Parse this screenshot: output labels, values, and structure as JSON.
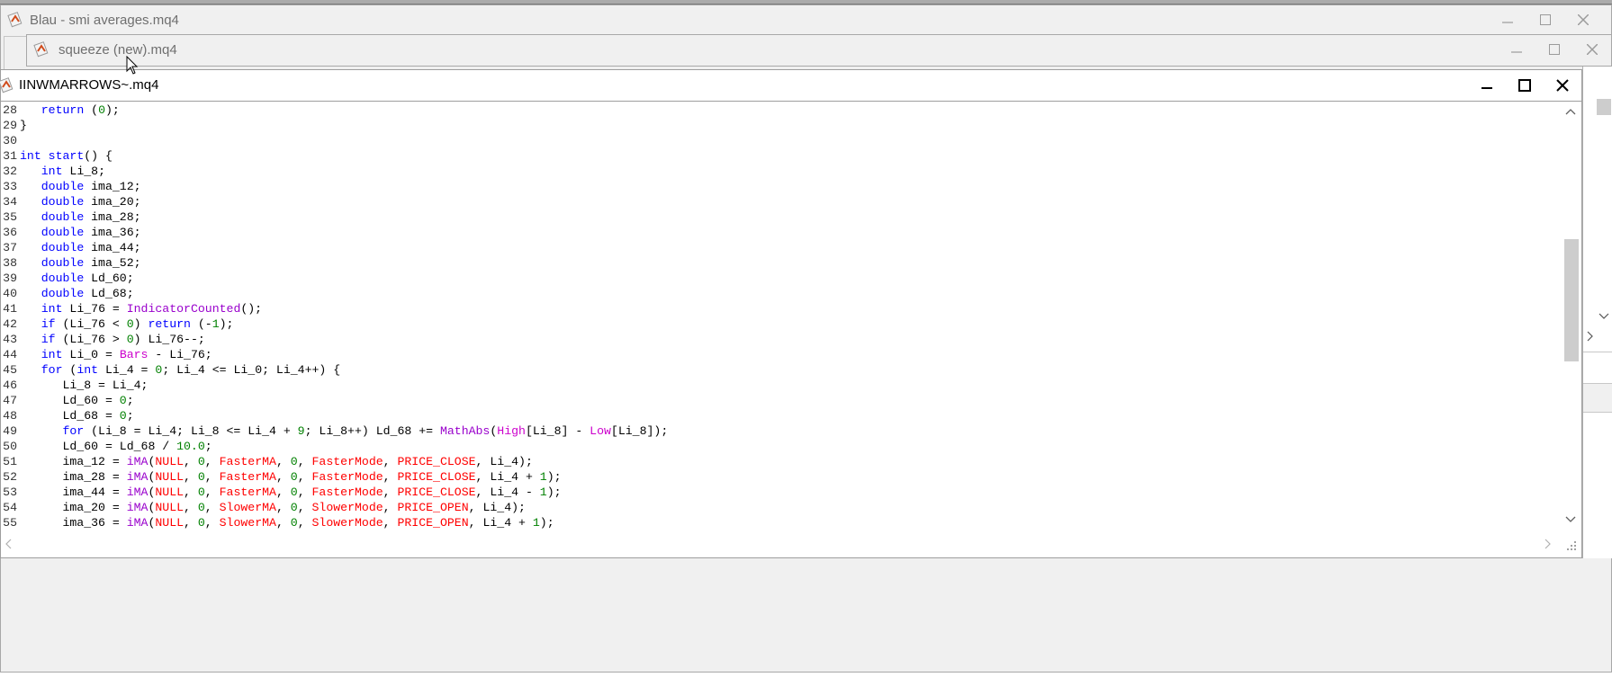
{
  "windows": {
    "back": {
      "title": "Blau - smi averages.mq4"
    },
    "middle": {
      "title": "squeeze (new).mq4"
    },
    "active": {
      "title": "IINWMARROWS~.mq4"
    }
  },
  "icons": {
    "app": "mq4-file-icon",
    "minimize": "minimize-icon",
    "maximize": "maximize-icon",
    "close": "close-icon"
  },
  "colors": {
    "keyword": "#0000ff",
    "function": "#9900cc",
    "number": "#008000",
    "macro": "#ff0000",
    "constant": "#cc00cc"
  },
  "code_lines": [
    {
      "num": "28",
      "tokens": [
        [
          "",
          "   "
        ],
        [
          "kw",
          "return"
        ],
        [
          "",
          " ("
        ],
        [
          "num",
          "0"
        ],
        [
          "",
          ");"
        ]
      ]
    },
    {
      "num": "29",
      "tokens": [
        [
          "",
          "}"
        ]
      ]
    },
    {
      "num": "30",
      "tokens": [
        [
          "",
          ""
        ]
      ]
    },
    {
      "num": "31",
      "tokens": [
        [
          "kw",
          "int"
        ],
        [
          "",
          " "
        ],
        [
          "kw",
          "start"
        ],
        [
          "",
          "() {"
        ]
      ]
    },
    {
      "num": "32",
      "tokens": [
        [
          "",
          "   "
        ],
        [
          "kw",
          "int"
        ],
        [
          "",
          " Li_8;"
        ]
      ]
    },
    {
      "num": "33",
      "tokens": [
        [
          "",
          "   "
        ],
        [
          "kw",
          "double"
        ],
        [
          "",
          " ima_12;"
        ]
      ]
    },
    {
      "num": "34",
      "tokens": [
        [
          "",
          "   "
        ],
        [
          "kw",
          "double"
        ],
        [
          "",
          " ima_20;"
        ]
      ]
    },
    {
      "num": "35",
      "tokens": [
        [
          "",
          "   "
        ],
        [
          "kw",
          "double"
        ],
        [
          "",
          " ima_28;"
        ]
      ]
    },
    {
      "num": "36",
      "tokens": [
        [
          "",
          "   "
        ],
        [
          "kw",
          "double"
        ],
        [
          "",
          " ima_36;"
        ]
      ]
    },
    {
      "num": "37",
      "tokens": [
        [
          "",
          "   "
        ],
        [
          "kw",
          "double"
        ],
        [
          "",
          " ima_44;"
        ]
      ]
    },
    {
      "num": "38",
      "tokens": [
        [
          "",
          "   "
        ],
        [
          "kw",
          "double"
        ],
        [
          "",
          " ima_52;"
        ]
      ]
    },
    {
      "num": "39",
      "tokens": [
        [
          "",
          "   "
        ],
        [
          "kw",
          "double"
        ],
        [
          "",
          " Ld_60;"
        ]
      ]
    },
    {
      "num": "40",
      "tokens": [
        [
          "",
          "   "
        ],
        [
          "kw",
          "double"
        ],
        [
          "",
          " Ld_68;"
        ]
      ]
    },
    {
      "num": "41",
      "tokens": [
        [
          "",
          "   "
        ],
        [
          "kw",
          "int"
        ],
        [
          "",
          " Li_76 = "
        ],
        [
          "fn",
          "IndicatorCounted"
        ],
        [
          "",
          "();"
        ]
      ]
    },
    {
      "num": "42",
      "tokens": [
        [
          "",
          "   "
        ],
        [
          "kw",
          "if"
        ],
        [
          "",
          " (Li_76 < "
        ],
        [
          "num",
          "0"
        ],
        [
          "",
          ") "
        ],
        [
          "kw",
          "return"
        ],
        [
          "",
          " (-"
        ],
        [
          "num",
          "1"
        ],
        [
          "",
          ");"
        ]
      ]
    },
    {
      "num": "43",
      "tokens": [
        [
          "",
          "   "
        ],
        [
          "kw",
          "if"
        ],
        [
          "",
          " (Li_76 > "
        ],
        [
          "num",
          "0"
        ],
        [
          "",
          ") Li_76--;"
        ]
      ]
    },
    {
      "num": "44",
      "tokens": [
        [
          "",
          "   "
        ],
        [
          "kw",
          "int"
        ],
        [
          "",
          " Li_0 = "
        ],
        [
          "cst",
          "Bars"
        ],
        [
          "",
          " - Li_76;"
        ]
      ]
    },
    {
      "num": "45",
      "tokens": [
        [
          "",
          "   "
        ],
        [
          "kw",
          "for"
        ],
        [
          "",
          " ("
        ],
        [
          "kw",
          "int"
        ],
        [
          "",
          " Li_4 = "
        ],
        [
          "num",
          "0"
        ],
        [
          "",
          "; Li_4 <= Li_0; Li_4++) {"
        ]
      ]
    },
    {
      "num": "46",
      "tokens": [
        [
          "",
          "      Li_8 = Li_4;"
        ]
      ]
    },
    {
      "num": "47",
      "tokens": [
        [
          "",
          "      Ld_60 = "
        ],
        [
          "num",
          "0"
        ],
        [
          "",
          ";"
        ]
      ]
    },
    {
      "num": "48",
      "tokens": [
        [
          "",
          "      Ld_68 = "
        ],
        [
          "num",
          "0"
        ],
        [
          "",
          ";"
        ]
      ]
    },
    {
      "num": "49",
      "tokens": [
        [
          "",
          "      "
        ],
        [
          "kw",
          "for"
        ],
        [
          "",
          " (Li_8 = Li_4; Li_8 <= Li_4 + "
        ],
        [
          "num",
          "9"
        ],
        [
          "",
          "; Li_8++) Ld_68 += "
        ],
        [
          "fn",
          "MathAbs"
        ],
        [
          "",
          "("
        ],
        [
          "cst",
          "High"
        ],
        [
          "",
          "[Li_8] - "
        ],
        [
          "cst",
          "Low"
        ],
        [
          "",
          "[Li_8]);"
        ]
      ]
    },
    {
      "num": "50",
      "tokens": [
        [
          "",
          "      Ld_60 = Ld_68 / "
        ],
        [
          "num",
          "10.0"
        ],
        [
          "",
          ";"
        ]
      ]
    },
    {
      "num": "51",
      "tokens": [
        [
          "",
          "      ima_12 = "
        ],
        [
          "fn",
          "iMA"
        ],
        [
          "",
          "("
        ],
        [
          "mac",
          "NULL"
        ],
        [
          "",
          ", "
        ],
        [
          "num",
          "0"
        ],
        [
          "",
          ", "
        ],
        [
          "mac",
          "FasterMA"
        ],
        [
          "",
          ", "
        ],
        [
          "num",
          "0"
        ],
        [
          "",
          ", "
        ],
        [
          "mac",
          "FasterMode"
        ],
        [
          "",
          ", "
        ],
        [
          "mac",
          "PRICE_CLOSE"
        ],
        [
          "",
          ", Li_4);"
        ]
      ]
    },
    {
      "num": "52",
      "tokens": [
        [
          "",
          "      ima_28 = "
        ],
        [
          "fn",
          "iMA"
        ],
        [
          "",
          "("
        ],
        [
          "mac",
          "NULL"
        ],
        [
          "",
          ", "
        ],
        [
          "num",
          "0"
        ],
        [
          "",
          ", "
        ],
        [
          "mac",
          "FasterMA"
        ],
        [
          "",
          ", "
        ],
        [
          "num",
          "0"
        ],
        [
          "",
          ", "
        ],
        [
          "mac",
          "FasterMode"
        ],
        [
          "",
          ", "
        ],
        [
          "mac",
          "PRICE_CLOSE"
        ],
        [
          "",
          ", Li_4 + "
        ],
        [
          "num",
          "1"
        ],
        [
          "",
          ");"
        ]
      ]
    },
    {
      "num": "53",
      "tokens": [
        [
          "",
          "      ima_44 = "
        ],
        [
          "fn",
          "iMA"
        ],
        [
          "",
          "("
        ],
        [
          "mac",
          "NULL"
        ],
        [
          "",
          ", "
        ],
        [
          "num",
          "0"
        ],
        [
          "",
          ", "
        ],
        [
          "mac",
          "FasterMA"
        ],
        [
          "",
          ", "
        ],
        [
          "num",
          "0"
        ],
        [
          "",
          ", "
        ],
        [
          "mac",
          "FasterMode"
        ],
        [
          "",
          ", "
        ],
        [
          "mac",
          "PRICE_CLOSE"
        ],
        [
          "",
          ", Li_4 - "
        ],
        [
          "num",
          "1"
        ],
        [
          "",
          ");"
        ]
      ]
    },
    {
      "num": "54",
      "tokens": [
        [
          "",
          "      ima_20 = "
        ],
        [
          "fn",
          "iMA"
        ],
        [
          "",
          "("
        ],
        [
          "mac",
          "NULL"
        ],
        [
          "",
          ", "
        ],
        [
          "num",
          "0"
        ],
        [
          "",
          ", "
        ],
        [
          "mac",
          "SlowerMA"
        ],
        [
          "",
          ", "
        ],
        [
          "num",
          "0"
        ],
        [
          "",
          ", "
        ],
        [
          "mac",
          "SlowerMode"
        ],
        [
          "",
          ", "
        ],
        [
          "mac",
          "PRICE_OPEN"
        ],
        [
          "",
          ", Li_4);"
        ]
      ]
    },
    {
      "num": "55",
      "tokens": [
        [
          "",
          "      ima_36 = "
        ],
        [
          "fn",
          "iMA"
        ],
        [
          "",
          "("
        ],
        [
          "mac",
          "NULL"
        ],
        [
          "",
          ", "
        ],
        [
          "num",
          "0"
        ],
        [
          "",
          ", "
        ],
        [
          "mac",
          "SlowerMA"
        ],
        [
          "",
          ", "
        ],
        [
          "num",
          "0"
        ],
        [
          "",
          ", "
        ],
        [
          "mac",
          "SlowerMode"
        ],
        [
          "",
          ", "
        ],
        [
          "mac",
          "PRICE_OPEN"
        ],
        [
          "",
          ", Li_4 + "
        ],
        [
          "num",
          "1"
        ],
        [
          "",
          ");"
        ]
      ]
    }
  ]
}
